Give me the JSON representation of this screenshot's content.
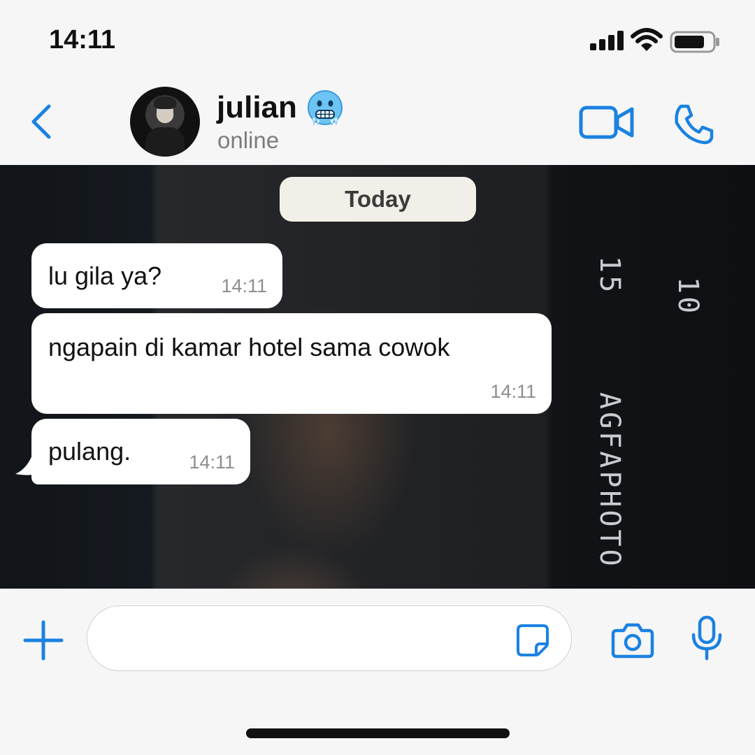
{
  "status_bar": {
    "time": "14:11",
    "icons": [
      "signal-icon",
      "wifi-icon",
      "battery-icon"
    ]
  },
  "header": {
    "contact_name": "julian",
    "contact_emoji": "cold-face-emoji",
    "contact_status": "online",
    "icons": [
      "back-chevron-icon",
      "video-call-icon",
      "phone-icon"
    ]
  },
  "chat": {
    "date_separator": "Today",
    "background_film_text": [
      "15",
      "10",
      "AGFAPHOTO"
    ],
    "messages": [
      {
        "text": "lu gila ya?",
        "time": "14:11"
      },
      {
        "text": "ngapain di kamar hotel sama cowok",
        "time": "14:11"
      },
      {
        "text": "pulang.",
        "time": "14:11"
      }
    ]
  },
  "input_bar": {
    "placeholder": "",
    "icons": [
      "plus-icon",
      "sticker-icon",
      "camera-icon",
      "microphone-icon"
    ]
  },
  "colors": {
    "accent": "#1a82e2",
    "background": "#f6f6f6",
    "bubble": "#ffffff",
    "date_pill": "#f2efe9",
    "timestamp": "#8e8e8e"
  }
}
